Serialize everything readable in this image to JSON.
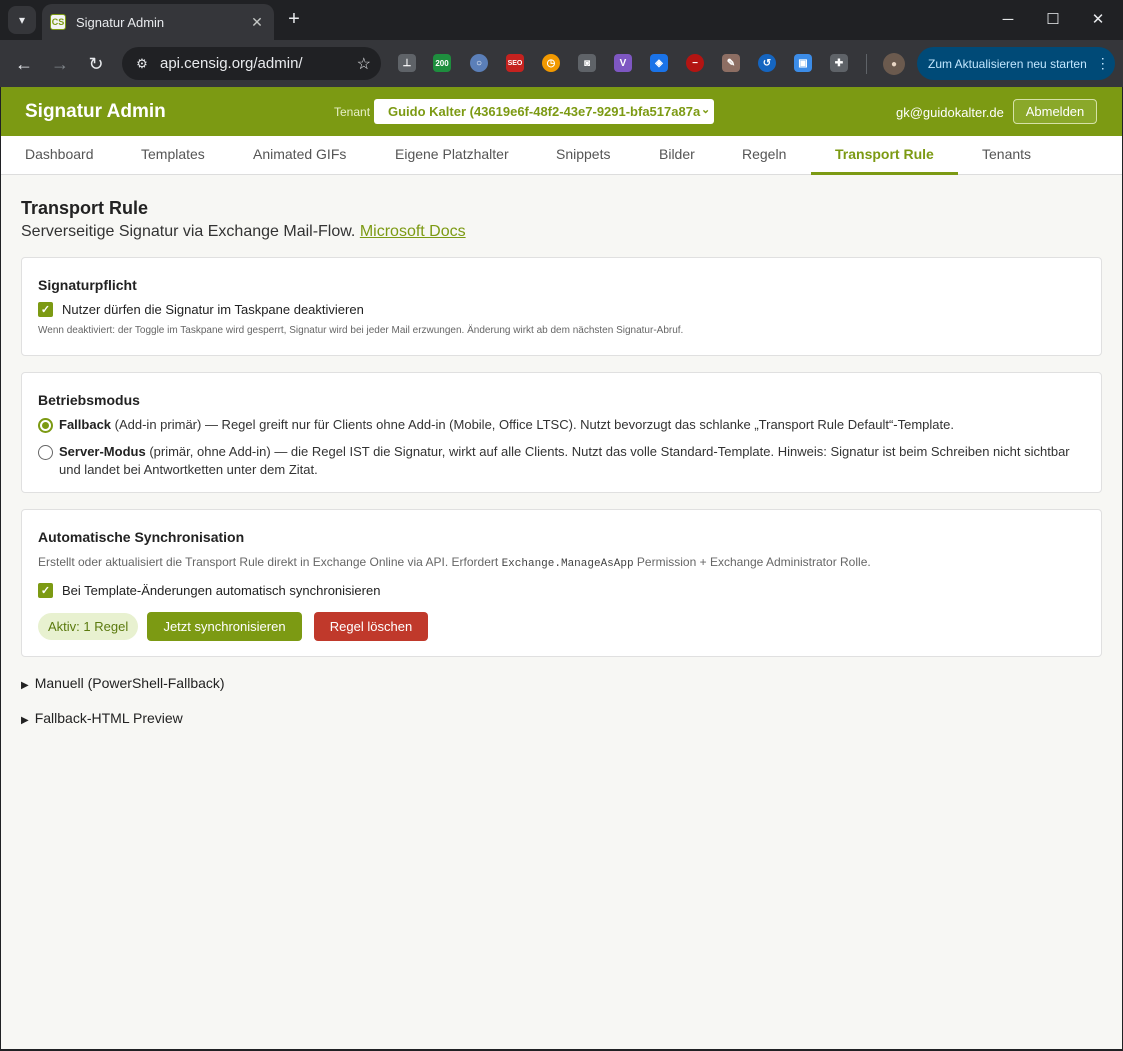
{
  "browser": {
    "tab_title": "Signatur Admin",
    "favicon_text": "CS",
    "url": "api.censig.org/admin/",
    "update_button_label": "Zum Aktualisieren neu starten",
    "ext_badge_count": "200",
    "ext_seo_label": "SEO"
  },
  "header": {
    "app_title": "Signatur Admin",
    "tenant_label": "Tenant",
    "tenant_value": "Guido Kalter (43619e6f-48f2-43e7-9291-bfa517a87a",
    "user_email": "gk@guidokalter.de",
    "logout_label": "Abmelden"
  },
  "nav": {
    "tabs": [
      {
        "label": "Dashboard"
      },
      {
        "label": "Templates"
      },
      {
        "label": "Animated GIFs"
      },
      {
        "label": "Eigene Platzhalter"
      },
      {
        "label": "Snippets"
      },
      {
        "label": "Bilder"
      },
      {
        "label": "Regeln"
      },
      {
        "label": "Transport Rule",
        "active": true
      },
      {
        "label": "Tenants"
      }
    ]
  },
  "page": {
    "title": "Transport Rule",
    "subtitle": "Serverseitige Signatur via Exchange Mail-Flow.",
    "docs_link": "Microsoft Docs"
  },
  "signaturpflicht": {
    "title": "Signaturpflicht",
    "checkbox_label": "Nutzer dürfen die Signatur im Taskpane deaktivieren",
    "checked": true,
    "hint": "Wenn deaktiviert: der Toggle im Taskpane wird gesperrt, Signatur wird bei jeder Mail erzwungen. Änderung wirkt ab dem nächsten Signatur-Abruf."
  },
  "betriebsmodus": {
    "title": "Betriebsmodus",
    "options": [
      {
        "name": "Fallback",
        "detail": " (Add-in primär) — Regel greift nur für Clients ohne Add-in (Mobile, Office LTSC). Nutzt bevorzugt das schlanke „Transport Rule Default“-Template.",
        "selected": true
      },
      {
        "name": "Server-Modus",
        "detail": " (primär, ohne Add-in) — die Regel IST die Signatur, wirkt auf alle Clients. Nutzt das volle Standard-Template. Hinweis: Signatur ist beim Schreiben nicht sichtbar und landet bei Antwortketten unter dem Zitat.",
        "selected": false
      }
    ]
  },
  "sync": {
    "title": "Automatische Synchronisation",
    "desc_prefix": "Erstellt oder aktualisiert die Transport Rule direkt in Exchange Online via API. Erfordert ",
    "desc_code": "Exchange.ManageAsApp",
    "desc_suffix": " Permission + Exchange Administrator Rolle.",
    "checkbox_label": "Bei Template-Änderungen automatisch synchronisieren",
    "checked": true,
    "status": "Aktiv: 1 Regel",
    "sync_button": "Jetzt synchronisieren",
    "delete_button": "Regel löschen"
  },
  "details": [
    {
      "label": "Manuell (PowerShell-Fallback)"
    },
    {
      "label": "Fallback-HTML Preview"
    }
  ],
  "colors": {
    "accent": "#7c9a13",
    "danger": "#c0392b",
    "badge_bg": "#e8f1d0"
  }
}
